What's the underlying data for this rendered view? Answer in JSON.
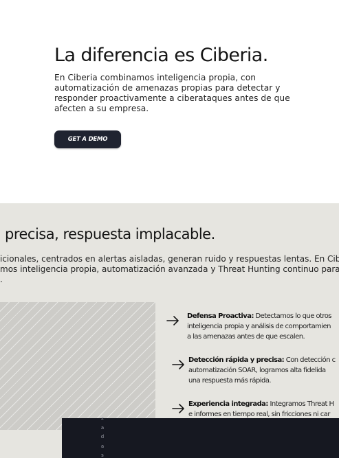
{
  "hero": {
    "title": "La diferencia es Ciberia.",
    "text": "En Ciberia combinamos inteligencia propia, con automatización de amenazas propias para detectar y responder proactivamente a ciberataques antes de que afecten a su empresa.",
    "cta_label": "GET A DEMO"
  },
  "section": {
    "title": "precisa, respuesta implacable.",
    "text_lines": [
      "icionales, centrados en alertas aisladas, generan ruido y respuestas lentas. En Ciber",
      "mos inteligencia propia, automatización avanzada y Threat Hunting continuo para de",
      "."
    ]
  },
  "features": [
    {
      "icon": "arrow-right-icon",
      "title": "Defensa Proactiva:",
      "lines": [
        " Detectamos lo que otros",
        "inteligencia propia y análisis de comportamien",
        "a las amenazas antes de que escalen."
      ]
    },
    {
      "icon": "arrow-right-icon",
      "title": "Detección rápida y precisa:",
      "lines": [
        " Con detección c",
        "automatización SOAR, logramos alta fidelida",
        "una respuesta más rápida."
      ]
    },
    {
      "icon": "arrow-right-icon",
      "title": "Experiencia integrada:",
      "lines": [
        " Integramos Threat H",
        "e informes en tiempo real, sin fricciones ni car"
      ]
    }
  ],
  "overlay": {
    "letters": [
      "z",
      "a",
      "d",
      "a",
      "s"
    ]
  },
  "colors": {
    "button_bg": "#1f2330",
    "section_bg": "#e6e5e0",
    "overlay_bg": "#161821"
  }
}
